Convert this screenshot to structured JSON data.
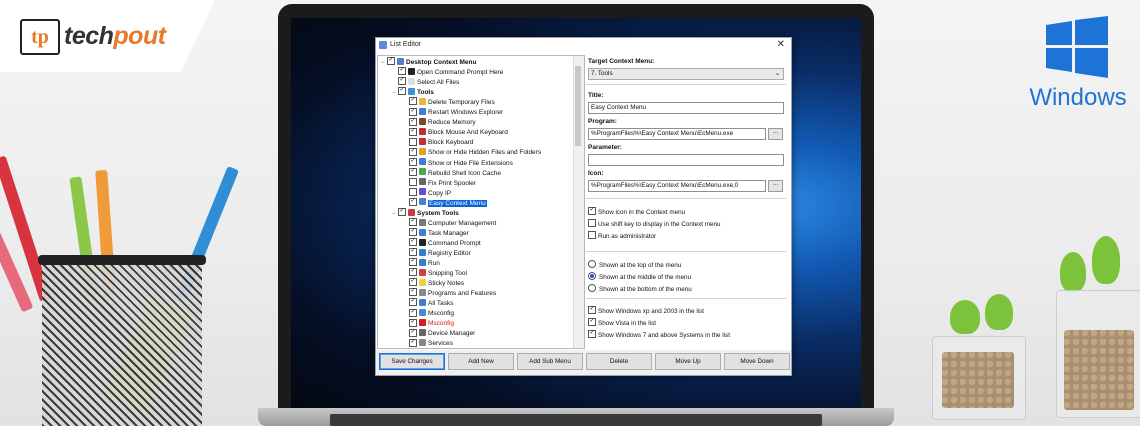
{
  "brand": {
    "logo_mark": "tp",
    "logo_text_a": "tech",
    "logo_text_b": "pout",
    "windows_label": "Windows",
    "windows_blue": "#1e73d6",
    "accent_orange": "#e8792b"
  },
  "window": {
    "title": "List Editor",
    "close_glyph": "✕"
  },
  "tree": {
    "items": [
      {
        "label": "Desktop Context Menu",
        "level": 0,
        "checked": true,
        "bold": true,
        "expander": "−",
        "icon": "#4d7fd1"
      },
      {
        "label": "Open Command Prompt Here",
        "level": 1,
        "checked": true,
        "icon": "#222"
      },
      {
        "label": "Select All Files",
        "level": 1,
        "checked": true,
        "icon": "#ddd"
      },
      {
        "label": "Tools",
        "level": 1,
        "checked": true,
        "bold": true,
        "expander": "−",
        "icon": "#3b8de0"
      },
      {
        "label": "Delete Temporary Files",
        "level": 2,
        "checked": true,
        "icon": "#f0b23a"
      },
      {
        "label": "Restart Windows Explorer",
        "level": 2,
        "checked": true,
        "icon": "#3d7fd6"
      },
      {
        "label": "Reduce Memory",
        "level": 2,
        "checked": true,
        "icon": "#7a4a2a"
      },
      {
        "label": "Block Mouse And Keyboard",
        "level": 2,
        "checked": true,
        "icon": "#c03030"
      },
      {
        "label": "Block Keyboard",
        "level": 2,
        "checked": false,
        "icon": "#c03030"
      },
      {
        "label": "Show or Hide Hidden Files and Folders",
        "level": 2,
        "checked": true,
        "icon": "#e2a02a"
      },
      {
        "label": "Show or Hide File Extensions",
        "level": 2,
        "checked": true,
        "icon": "#3d7fd6"
      },
      {
        "label": "Rebuild Shell Icon Cache",
        "level": 2,
        "checked": true,
        "icon": "#4aa84a"
      },
      {
        "label": "Fix Print Spooler",
        "level": 2,
        "checked": false,
        "icon": "#666"
      },
      {
        "label": "Copy IP",
        "level": 2,
        "checked": false,
        "icon": "#6a4ad0"
      },
      {
        "label": "Easy Context Menu",
        "level": 2,
        "checked": true,
        "selected": true,
        "icon": "#4d7fd1"
      },
      {
        "label": "System Tools",
        "level": 1,
        "checked": true,
        "bold": true,
        "expander": "−",
        "icon": "#c04040"
      },
      {
        "label": "Computer Management",
        "level": 2,
        "checked": true,
        "icon": "#777"
      },
      {
        "label": "Task Manager",
        "level": 2,
        "checked": true,
        "icon": "#3d7fd6"
      },
      {
        "label": "Command Prompt",
        "level": 2,
        "checked": true,
        "icon": "#222"
      },
      {
        "label": "Registry Editor",
        "level": 2,
        "checked": true,
        "icon": "#2f7fcf"
      },
      {
        "label": "Run",
        "level": 2,
        "checked": true,
        "icon": "#2f7fcf"
      },
      {
        "label": "Snipping Tool",
        "level": 2,
        "checked": true,
        "icon": "#d04040"
      },
      {
        "label": "Sticky Notes",
        "level": 2,
        "checked": true,
        "icon": "#f0d040"
      },
      {
        "label": "Programs and Features",
        "level": 2,
        "checked": true,
        "icon": "#888"
      },
      {
        "label": "All Tasks",
        "level": 2,
        "checked": true,
        "icon": "#3d7fd6"
      },
      {
        "label": "Msconfig",
        "level": 2,
        "checked": true,
        "icon": "#4a8ad0"
      },
      {
        "label": "Msconfig",
        "level": 2,
        "checked": true,
        "red": true,
        "icon": "#d02020"
      },
      {
        "label": "Device Manager",
        "level": 2,
        "checked": true,
        "icon": "#666"
      },
      {
        "label": "Services",
        "level": 2,
        "checked": true,
        "icon": "#888"
      }
    ]
  },
  "panel": {
    "target_label": "Target Context Menu:",
    "target_value": "7. Tools",
    "title_label": "Title:",
    "title_value": "Easy Context Menu",
    "program_label": "Program:",
    "program_value": "%ProgramFiles%\\Easy Context Menu\\EcMenu.exe",
    "parameter_label": "Parameter:",
    "parameter_value": "",
    "icon_label": "Icon:",
    "icon_value": "%ProgramFiles%\\Easy Context Menu\\EcMenu.exe,0",
    "browse_glyph": "...",
    "checks1": [
      {
        "label": "Show icon in the Context menu",
        "checked": true
      },
      {
        "label": "Use shift key to display in the Context menu",
        "checked": false
      },
      {
        "label": "Run as administrator",
        "checked": false
      }
    ],
    "radios": [
      {
        "label": "Shown at the top of the menu",
        "selected": false
      },
      {
        "label": "Shown at the middle of the menu",
        "selected": true
      },
      {
        "label": "Shown at the bottom of the menu",
        "selected": false
      }
    ],
    "checks2": [
      {
        "label": "Show Windows xp  and 2003 in the list",
        "checked": true
      },
      {
        "label": "Show Vista in the list",
        "checked": true
      },
      {
        "label": "Show Windows 7 and above Systems in the list",
        "checked": true
      }
    ]
  },
  "buttons": {
    "save": "Save Changes",
    "add_new": "Add New",
    "add_sub_menu": "Add Sub Menu",
    "delete": "Delete",
    "move_up": "Move Up",
    "move_down": "Move Down"
  }
}
